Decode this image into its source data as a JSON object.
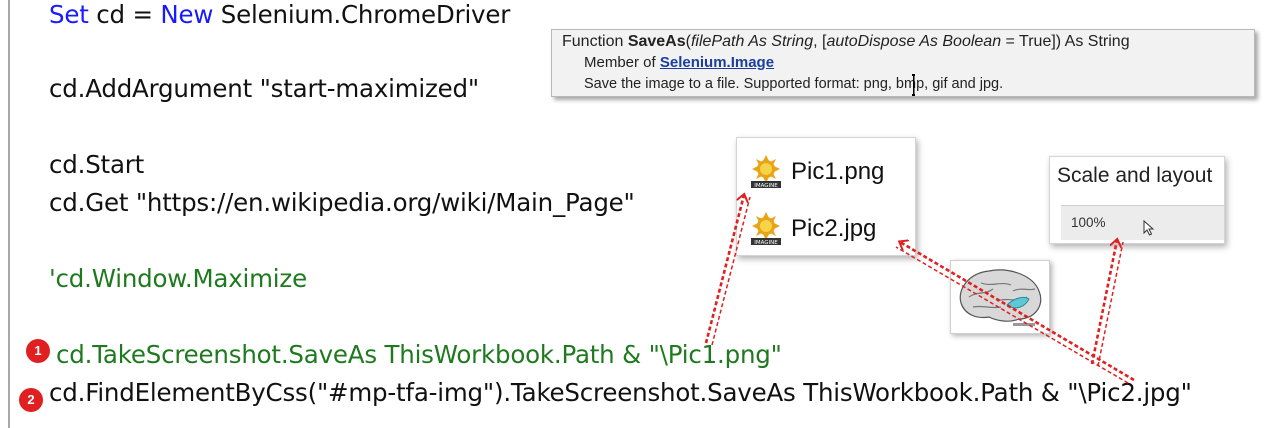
{
  "code": {
    "line1": {
      "keyword1": "Set",
      "plain1": " cd = ",
      "keyword2": "New",
      "plain2": " Selenium.ChromeDriver"
    },
    "line2": "cd.AddArgument \"start-maximized\"",
    "line3": "cd.Start",
    "line4": "cd.Get \"https://en.wikipedia.org/wiki/Main_Page\"",
    "line5": "'cd.Window.Maximize",
    "line6": "cd.TakeScreenshot.SaveAs ThisWorkbook.Path & \"\\Pic1.png\"",
    "line7": "cd.FindElementByCss(\"#mp-tfa-img\").TakeScreenshot.SaveAs ThisWorkbook.Path & \"\\Pic2.jpg\""
  },
  "badges": {
    "one": "1",
    "two": "2"
  },
  "tooltip": {
    "sig_prefix": "Function ",
    "sig_name": "SaveAs",
    "sig_open": "(",
    "sig_param1": "filePath As String",
    "sig_mid": ", [",
    "sig_param2": "autoDispose As Boolean",
    "sig_end": " = True]) As String",
    "member_prefix": "Member of ",
    "member_link": "Selenium.Image",
    "description": "Save the image to a file. Supported format: png, bmp, gif and jpg."
  },
  "files": [
    {
      "name": "Pic1.png",
      "icon": "image-file-icon"
    },
    {
      "name": "Pic2.jpg",
      "icon": "image-file-icon"
    }
  ],
  "icon_caption": "IMAGINE",
  "scale": {
    "title": "Scale and layout",
    "value": "100%"
  },
  "colors": {
    "keyword": "#1a1aff",
    "comment": "#1f7a1f",
    "arrow": "#e02020",
    "badge": "#e02020"
  }
}
